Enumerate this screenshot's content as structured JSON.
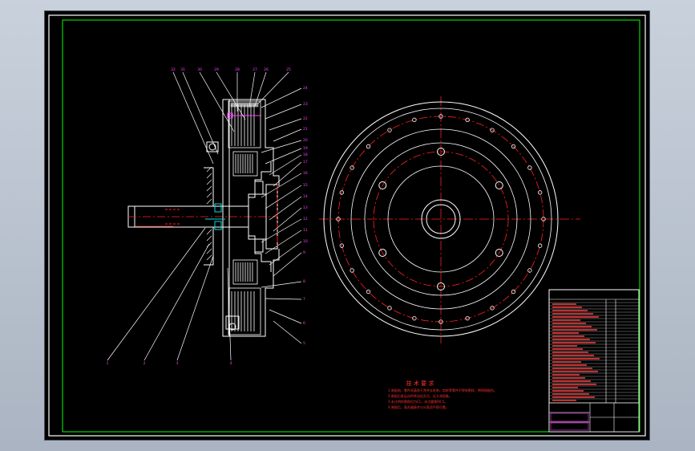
{
  "notes": {
    "title": "技  术  要  求",
    "lines": [
      "1.装配前，零件须清洗干净并去毛刺，齿轮等零件不得有裂纹、锈蚀和碰伤。",
      "2.装配后各运动件转动应灵活，无卡滞现象。",
      "3.未注明的倒角均为C1，未注圆角R0.5。",
      "4.装配后，离合器接合与分离须平稳可靠。"
    ]
  },
  "colors": {
    "background": "#000000",
    "frame": "#ffffff",
    "inner_frame": "#00ff00",
    "outline": "#ffffff",
    "centerline": "#ff2020",
    "leader": "#ffffff",
    "part_label": "#ff40ff",
    "note_text": "#ff3030",
    "hatch": "#ffffff",
    "accent_cyan": "#00e0e0",
    "table_text": "#ff4040"
  },
  "part_numbers": {
    "top": [
      "32",
      "31",
      "30",
      "29",
      "28",
      "27",
      "26",
      "25"
    ],
    "right": [
      "24",
      "23",
      "22",
      "21",
      "20",
      "19",
      "18",
      "17",
      "16",
      "15",
      "14",
      "13",
      "12",
      "11",
      "10",
      "9",
      "8",
      "7",
      "6",
      "5"
    ],
    "bottom": [
      "1",
      "2",
      "3",
      "4"
    ]
  }
}
